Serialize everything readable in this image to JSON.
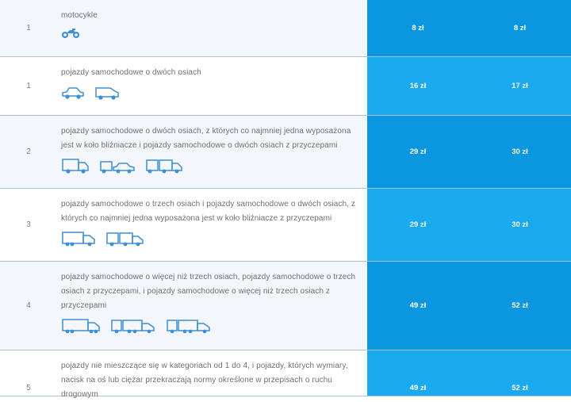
{
  "colors": {
    "price_dark": "#0b97df",
    "price_light": "#1ba9f0",
    "icon_blue": "#3d8fd6",
    "row_alt": "#f3f6fa",
    "divider": "#a9c3dd"
  },
  "rows": [
    {
      "num": "1",
      "desc": "motocykle",
      "icons": [
        "motorcycle-icon"
      ],
      "price1": "8 zł",
      "price2": "8 zł"
    },
    {
      "num": "1",
      "desc": "pojazdy samochodowe o dwóch osiach",
      "icons": [
        "car-icon",
        "van-icon"
      ],
      "price1": "16 zł",
      "price2": "17 zł"
    },
    {
      "num": "2",
      "desc_lines": [
        "pojazdy samochodowe o dwóch osiach, z których co najmniej jedna wyposażona",
        "jest w koło bliźniacze i pojazdy samochodowe o dwóch osiach z przyczepami"
      ],
      "icons": [
        "truck-two-axle-icon",
        "van-with-car-trailer-icon",
        "truck-with-trailer-icon"
      ],
      "price1": "29 zł",
      "price2": "30 zł"
    },
    {
      "num": "3",
      "desc_lines": [
        "pojazdy samochodowe o trzech osiach i pojazdy samochodowe o dwóch osiach, z",
        "których co najmniej jedna wyposażona jest w koło bliźniacze z przyczepami"
      ],
      "icons": [
        "truck-three-axle-icon",
        "truck-with-trailer-icon"
      ],
      "price1": "29 zł",
      "price2": "30 zł"
    },
    {
      "num": "4",
      "desc_lines": [
        "pojazdy samochodowe o więcej niż trzech osiach, pojazdy samochodowe o trzech",
        "osiach z przyczepami, i pojazdy samochodowe o więcej niż trzech osiach z",
        "przyczepami"
      ],
      "icons": [
        "truck-four-axle-icon",
        "truck-with-long-trailer-icon",
        "truck-with-long-trailer-icon"
      ],
      "price1": "49 zł",
      "price2": "52 zł"
    },
    {
      "num": "5",
      "desc_lines": [
        "pojazdy nie mieszczące się w kategoriach od 1 do 4, i pojazdy, których wymiary,",
        "nacisk na oś lub ciężar przekraczają normy określone w przepisach o ruchu",
        "drogowym"
      ],
      "icons": [],
      "price1": "49 zł",
      "price2": "52 zł"
    }
  ]
}
